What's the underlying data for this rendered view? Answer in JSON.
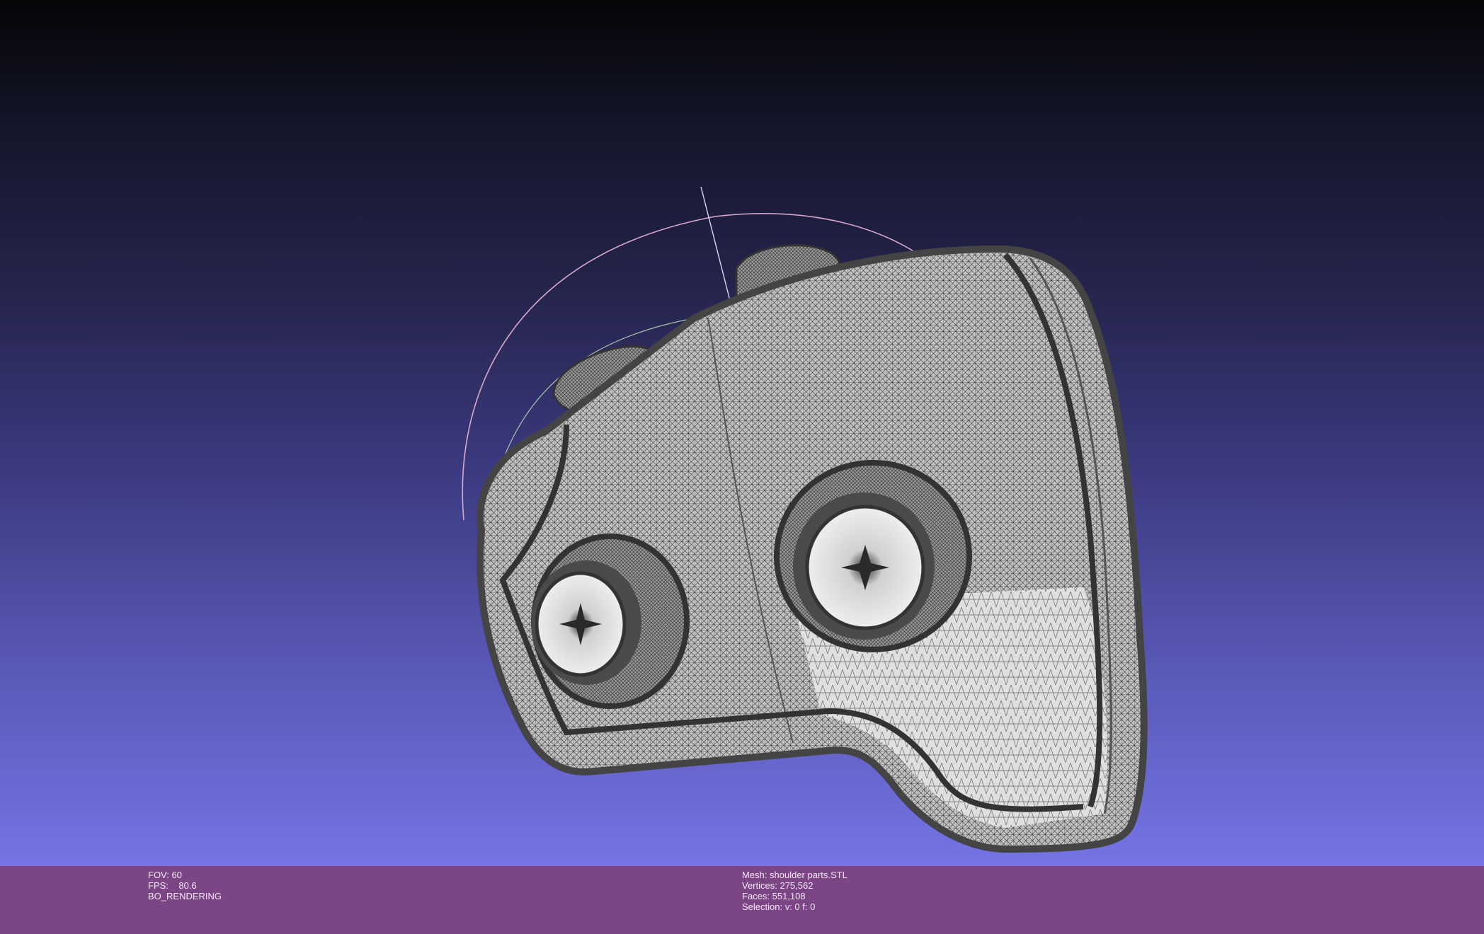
{
  "viewer": {
    "background": {
      "top": "#050507",
      "bottom": "#7474e6"
    },
    "info_bar_color": "#7c4585",
    "mesh_fill": "#bdbdbd",
    "mesh_edge": "#3a3a3a"
  },
  "info_left": {
    "fov": "FOV: 60",
    "fps": "FPS:    80.6",
    "mode": "BO_RENDERING"
  },
  "info_right": {
    "mesh": "Mesh: shoulder parts.STL",
    "vertices": "Vertices: 275,562",
    "faces": "Faces: 551,108",
    "selection": "Selection: v: 0 f: 0"
  }
}
